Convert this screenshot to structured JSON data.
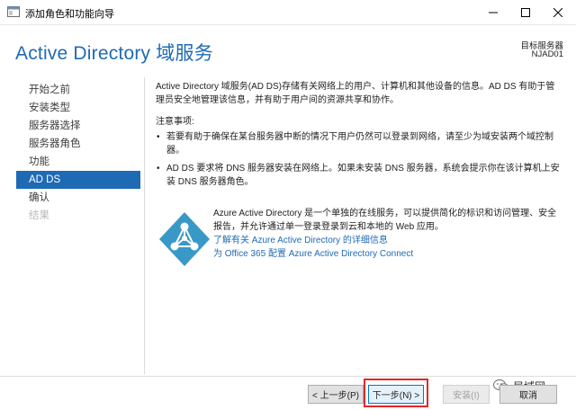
{
  "window": {
    "title": "添加角色和功能向导"
  },
  "header": {
    "page_title": "Active Directory 域服务",
    "server_label": "目标服务器",
    "server_name": "NJAD01"
  },
  "sidebar": {
    "items": [
      {
        "label": "开始之前",
        "state": "normal"
      },
      {
        "label": "安装类型",
        "state": "normal"
      },
      {
        "label": "服务器选择",
        "state": "normal"
      },
      {
        "label": "服务器角色",
        "state": "normal"
      },
      {
        "label": "功能",
        "state": "normal"
      },
      {
        "label": "AD DS",
        "state": "active"
      },
      {
        "label": "确认",
        "state": "normal"
      },
      {
        "label": "结果",
        "state": "disabled"
      }
    ]
  },
  "content": {
    "intro": "Active Directory 域服务(AD DS)存储有关网络上的用户、计算机和其他设备的信息。AD DS 有助于管理员安全地管理该信息，并有助于用户间的资源共享和协作。",
    "notes_heading": "注意事项:",
    "bullets": [
      "若要有助于确保在某台服务器中断的情况下用户仍然可以登录到网络，请至少为域安装两个域控制器。",
      "AD DS 要求将 DNS 服务器安装在网络上。如果未安装 DNS 服务器，系统会提示你在该计算机上安装 DNS 服务器角色。"
    ]
  },
  "azure": {
    "description": "Azure Active Directory 是一个单独的在线服务，可以提供简化的标识和访问管理、安全报告，并允许通过单一登录登录到云和本地的 Web 应用。",
    "link_learn_more": "了解有关 Azure Active Directory 的详细信息",
    "link_connect": "为 Office 365 配置 Azure Active Directory Connect",
    "logo_color": "#3999c6"
  },
  "footer": {
    "prev_label": "< 上一步(P)",
    "next_label": "下一步(N) >",
    "install_label": "安装(I)",
    "cancel_label": "取消"
  },
  "watermark": {
    "text": "局域网"
  },
  "colors": {
    "accent": "#1f6ab5",
    "highlight": "#e0282a"
  }
}
